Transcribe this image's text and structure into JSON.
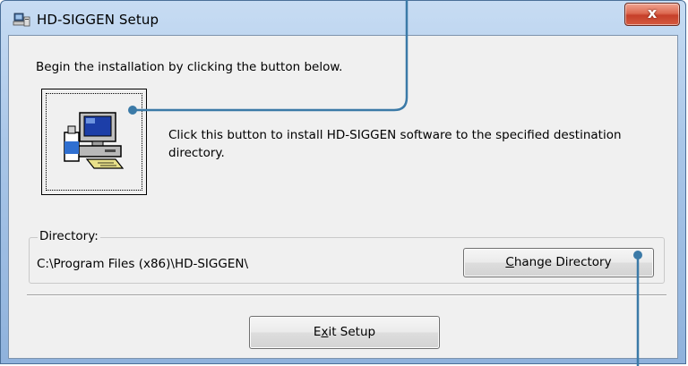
{
  "window": {
    "title": "HD-SIGGEN Setup",
    "close_glyph": "x",
    "app_icon": "setup-computer-icon"
  },
  "content": {
    "intro_text": "Begin the installation by clicking the button below.",
    "install_button_icon": "installer-computer-icon",
    "install_description": "Click this button to install HD-SIGGEN software to the specified destination directory."
  },
  "directory": {
    "legend": "Directory:",
    "path": "C:\\Program Files (x86)\\HD-SIGGEN\\",
    "change_button_accel": "C",
    "change_button_rest": "hange Directory"
  },
  "footer": {
    "exit_button_pre": "E",
    "exit_button_accel": "x",
    "exit_button_rest": "it Setup"
  },
  "colors": {
    "callout_line": "#3b7aa7",
    "title_gradient_top": "#c7dcf3",
    "close_button": "#c6402a"
  }
}
